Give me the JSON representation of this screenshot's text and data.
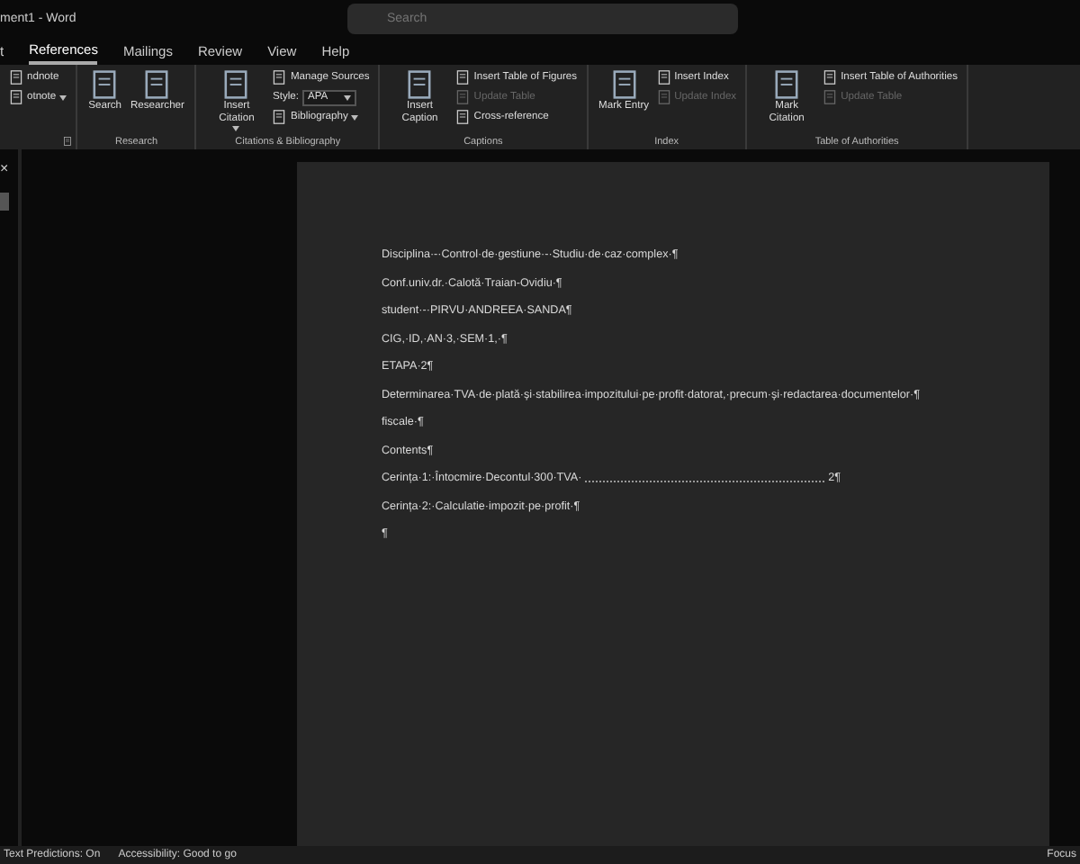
{
  "window": {
    "title": "ment1 - Word",
    "search": {
      "placeholder": "Search"
    }
  },
  "tabs": [
    {
      "label": "t",
      "selected": false
    },
    {
      "label": "References",
      "selected": true
    },
    {
      "label": "Mailings",
      "selected": false
    },
    {
      "label": "Review",
      "selected": false
    },
    {
      "label": "View",
      "selected": false
    },
    {
      "label": "Help",
      "selected": false
    }
  ],
  "ribbon": {
    "groups": [
      {
        "launcher": true,
        "items": [
          {
            "kind": "small",
            "label": "ndnote"
          },
          {
            "kind": "small",
            "label": "otnote",
            "dropdown": true
          }
        ]
      },
      {
        "label": "Research",
        "items": [
          {
            "kind": "large",
            "label": "Search"
          },
          {
            "kind": "large",
            "label": "Researcher"
          }
        ]
      },
      {
        "label": "Citations & Bibliography",
        "items": [
          {
            "kind": "large",
            "label": "Insert Citation",
            "dropdown": true
          },
          {
            "kind": "small",
            "label": "Manage Sources"
          },
          {
            "kind": "select",
            "label": "Style:",
            "value": "APA",
            "dropdown": true
          },
          {
            "kind": "small",
            "label": "Bibliography",
            "dropdown": true
          }
        ]
      },
      {
        "label": "Captions",
        "items": [
          {
            "kind": "large",
            "label": "Insert Caption"
          },
          {
            "kind": "small",
            "label": "Insert Table of Figures"
          },
          {
            "kind": "small",
            "label": "Update Table",
            "disabled": true
          },
          {
            "kind": "small",
            "label": "Cross-reference"
          }
        ]
      },
      {
        "label": "Index",
        "items": [
          {
            "kind": "large",
            "label": "Mark Entry"
          },
          {
            "kind": "small",
            "label": "Insert Index"
          },
          {
            "kind": "small",
            "label": "Update Index",
            "disabled": true
          }
        ]
      },
      {
        "label": "Table of Authorities",
        "items": [
          {
            "kind": "large",
            "label": "Mark Citation"
          },
          {
            "kind": "small",
            "label": "Insert Table of Authorities"
          },
          {
            "kind": "small",
            "label": "Update Table",
            "disabled": true
          }
        ]
      }
    ]
  },
  "navigation_pane": {
    "close": "×"
  },
  "document": {
    "paragraphs": [
      {
        "kind": "text",
        "text": "Disciplina·-·Control·de·gestiune·-·Studiu·de·caz·complex·¶"
      },
      {
        "kind": "text",
        "text": "Conf.univ.dr.·Calotă·Traian-Ovidiu·¶"
      },
      {
        "kind": "text",
        "text": "student·-·PIRVU·ANDREEA·SANDA¶"
      },
      {
        "kind": "text",
        "text": "CIG,·ID,·AN·3,·SEM·1,·¶"
      },
      {
        "kind": "text",
        "text": "ETAPA·2¶"
      },
      {
        "kind": "text",
        "text": "Determinarea·TVA·de·plată·și·stabilirea·impozitului·pe·profit·datorat,·precum·și·redactarea·documentelor·¶"
      },
      {
        "kind": "text",
        "text": "fiscale·¶"
      },
      {
        "kind": "text",
        "text": "Contents¶"
      },
      {
        "kind": "toc",
        "text": "Cerința·1:·Întocmire·Decontul·300·TVA·",
        "page": "2¶"
      },
      {
        "kind": "text",
        "text": "Cerința·2:·Calculatie·impozit·pe·profit·¶"
      },
      {
        "kind": "text",
        "text": "¶"
      }
    ]
  },
  "status_bar": {
    "left": [
      "Text Predictions: On",
      "Accessibility: Good to go"
    ],
    "right": "Focus"
  }
}
